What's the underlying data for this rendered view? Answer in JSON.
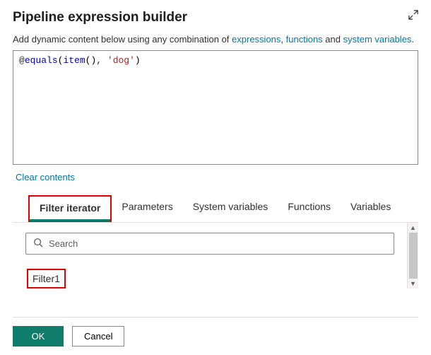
{
  "header": {
    "title": "Pipeline expression builder",
    "subtitle_prefix": "Add dynamic content below using any combination of ",
    "link_expressions": "expressions",
    "sep1": ", ",
    "link_functions": "functions",
    "sep2": " and ",
    "link_sysvars": "system variables",
    "period": "."
  },
  "editor": {
    "at": "@",
    "fn1": "equals",
    "open1": "(",
    "fn2": "item",
    "open2": "(",
    "close2": ")",
    "comma": ", ",
    "str": "'dog'",
    "close1": ")"
  },
  "clear_label": "Clear contents",
  "tabs": [
    {
      "label": "Filter iterator",
      "active": true,
      "highlight": true
    },
    {
      "label": "Parameters",
      "active": false,
      "highlight": false
    },
    {
      "label": "System variables",
      "active": false,
      "highlight": false
    },
    {
      "label": "Functions",
      "active": false,
      "highlight": false
    },
    {
      "label": "Variables",
      "active": false,
      "highlight": false
    }
  ],
  "search": {
    "placeholder": "Search",
    "value": ""
  },
  "items": [
    {
      "label": "Filter1",
      "highlight": true
    }
  ],
  "footer": {
    "ok": "OK",
    "cancel": "Cancel"
  }
}
